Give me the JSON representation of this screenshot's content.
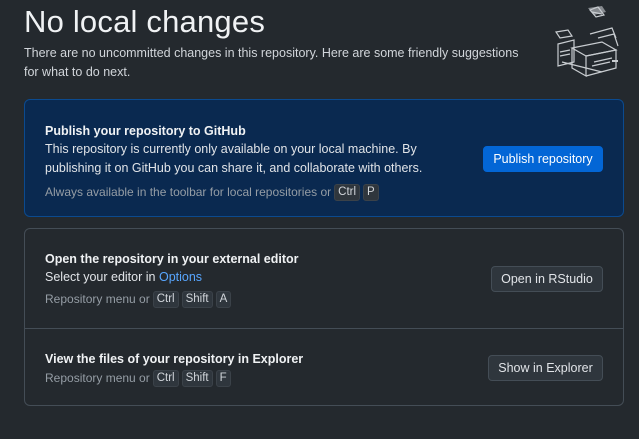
{
  "header": {
    "title": "No local changes",
    "subtitle": "There are no uncommitted changes in this repository. Here are some friendly suggestions for what to do next."
  },
  "publish": {
    "title": "Publish your repository to GitHub",
    "description": "This repository is currently only available on your local machine. By publishing it on GitHub you can share it, and collaborate with others.",
    "hint": "Always available in the toolbar for local repositories or",
    "keys": [
      "Ctrl",
      "P"
    ],
    "button": "Publish repository"
  },
  "editor": {
    "title": "Open the repository in your external editor",
    "description_prefix": "Select your editor in",
    "link": "Options",
    "hint": "Repository menu or",
    "keys": [
      "Ctrl",
      "Shift",
      "A"
    ],
    "button": "Open in RStudio"
  },
  "explorer": {
    "title": "View the files of your repository in Explorer",
    "hint": "Repository menu or",
    "keys": [
      "Ctrl",
      "Shift",
      "F"
    ],
    "button": "Show in Explorer"
  }
}
